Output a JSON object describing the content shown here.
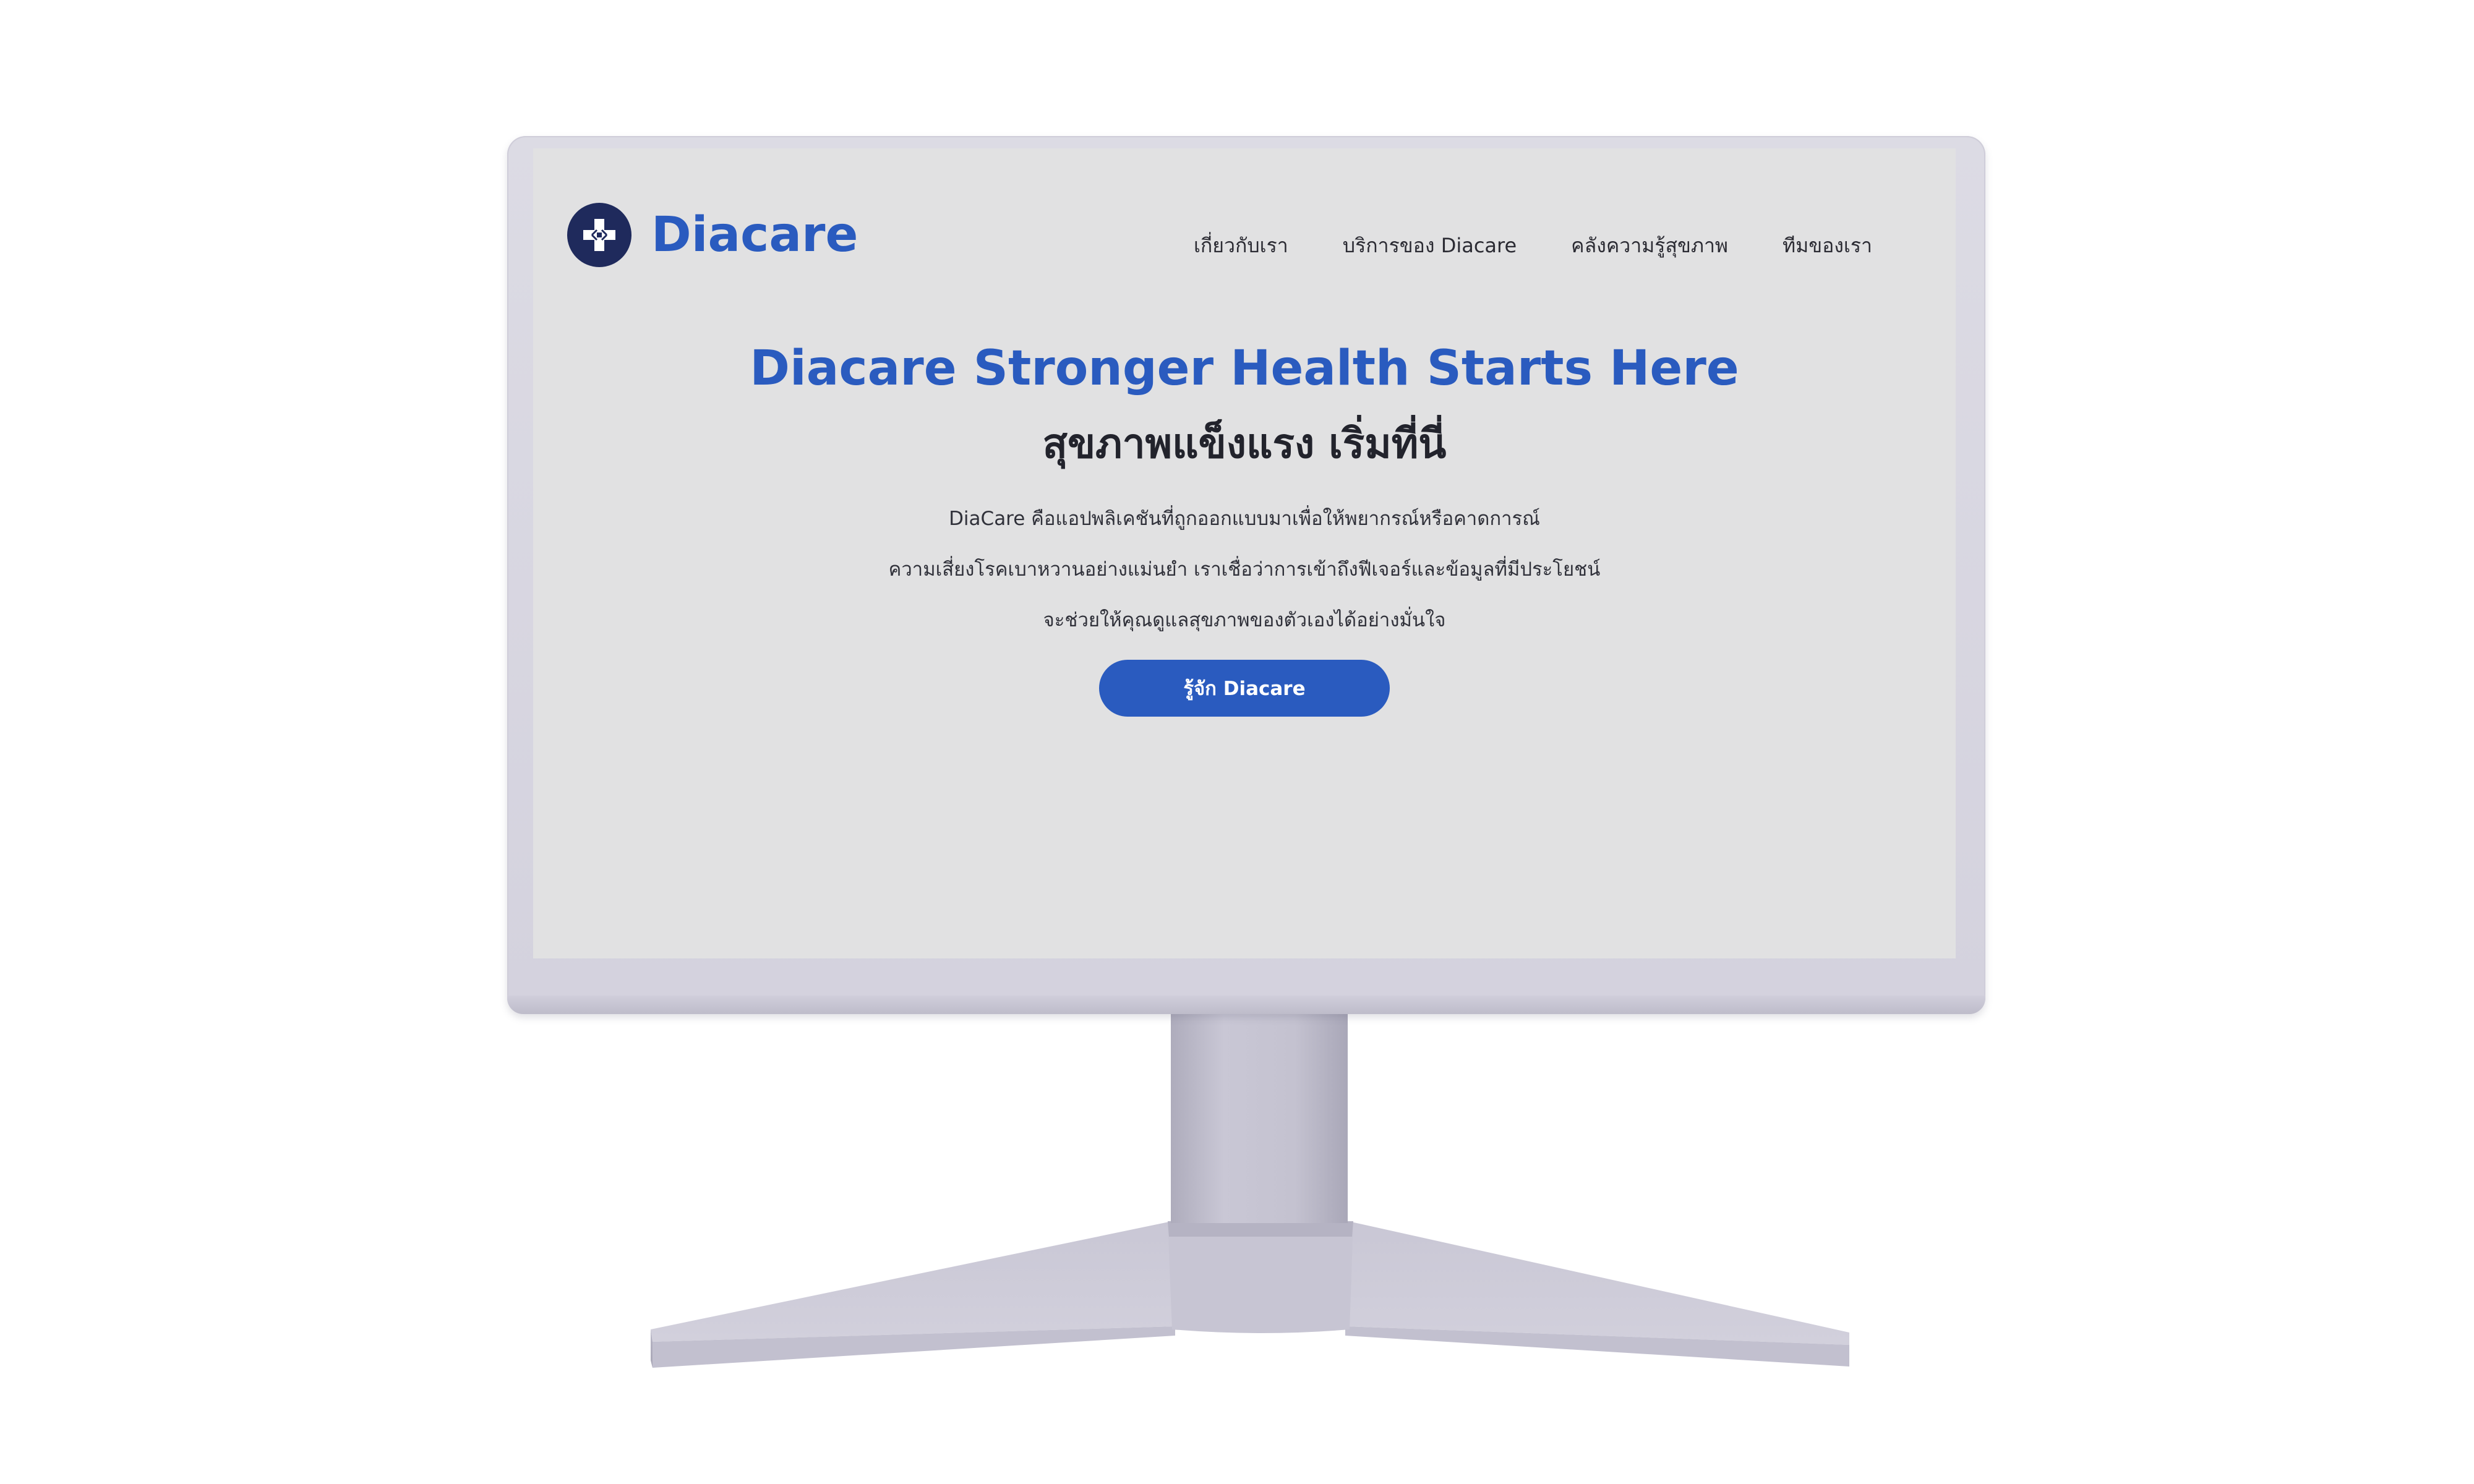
{
  "site": {
    "logo_text": "Diacare",
    "logo_icon": "medical-cross-icon"
  },
  "nav": {
    "items": [
      {
        "label": "เกี่ยวกับเรา"
      },
      {
        "label": "บริการของ Diacare"
      },
      {
        "label": "คลังความรู้สุขภาพ"
      },
      {
        "label": "ทีมของเรา"
      }
    ]
  },
  "hero": {
    "title": "Diacare Stronger Health Starts Here",
    "subtitle": "สุขภาพแข็งแรง เริ่มที่นี่",
    "description_lines": [
      "DiaCare คือแอปพลิเคชันที่ถูกออกแบบมาเพื่อให้พยากรณ์หรือคาดการณ์",
      "ความเสี่ยงโรคเบาหวานอย่างแม่นยำ เราเชื่อว่าการเข้าถึงฟีเจอร์และข้อมูลที่มีประโยชน์",
      "จะช่วยให้คุณดูแลสุขภาพของตัวเองได้อย่างมั่นใจ"
    ],
    "cta_label": "รู้จัก Diacare"
  },
  "colors": {
    "brand_blue": "#2a5bbf",
    "logo_navy": "#1f2a5c",
    "screen_bg": "#e1e1e2",
    "monitor_body": "#d6d4df"
  }
}
